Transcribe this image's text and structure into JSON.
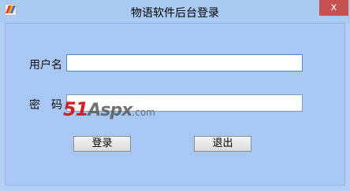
{
  "window": {
    "title": "物语软件后台登录",
    "close_glyph": "x"
  },
  "form": {
    "username_label": "用户名",
    "username_value": "",
    "password_label": "密　码",
    "password_value": ""
  },
  "watermark": {
    "part1": "51",
    "part2": "Aspx",
    "part3": ".com"
  },
  "buttons": {
    "login_label": "登录",
    "exit_label": "退出"
  }
}
